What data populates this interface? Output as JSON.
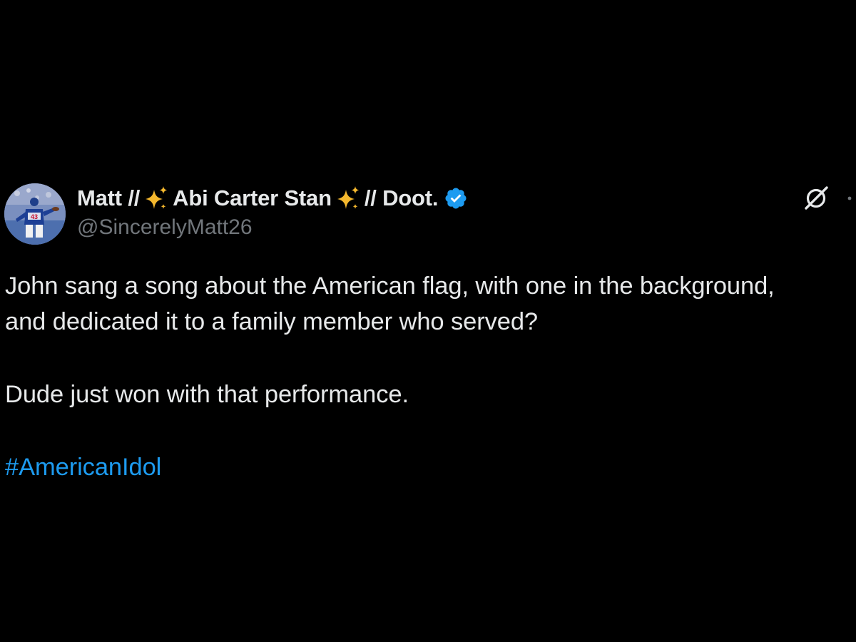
{
  "tweet": {
    "author": {
      "name_part1": "Matt //",
      "name_part2": "Abi Carter Stan",
      "name_part3": "// Doot.",
      "handle": "@SincerelyMatt26",
      "avatar_icon": "avatar-photo",
      "verified_icon": "verified-badge-icon",
      "sparkle_icon": "sparkles-emoji"
    },
    "text_line1": "John sang a song about the American flag, with one in the background,",
    "text_line2": "and dedicated it to a family member who served?",
    "text_line3": "Dude just won with that performance.",
    "hashtag": "#AmericanIdol",
    "toolbar": {
      "grok_icon": "grok-icon",
      "more_icon": "more-options-icon"
    },
    "colors": {
      "background": "#000000",
      "text": "#e7e9ea",
      "secondary": "#71767b",
      "link": "#1d9bf0",
      "verified": "#1d9bf0",
      "sparkle": "#f5b82e"
    }
  }
}
